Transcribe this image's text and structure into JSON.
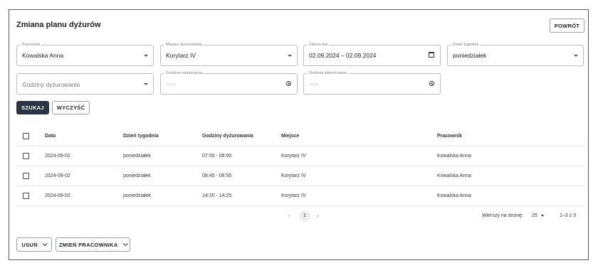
{
  "page": {
    "title": "Zmiana planu dyżurów"
  },
  "actions": {
    "back": "POWRÓT",
    "search": "SZUKAJ",
    "clear": "WYCZYŚĆ",
    "delete": "USUŃ",
    "change_employee": "ZMIEŃ PRACOWNIKA"
  },
  "filters": {
    "employee": {
      "label": "Pracownik",
      "value": "Kowalska Anna"
    },
    "place": {
      "label": "Miejsce dyżurowania",
      "value": "Korytarz IV"
    },
    "date_range": {
      "label": "Zakres dat",
      "value": "02.09.2024 – 02.09.2024"
    },
    "weekday": {
      "label": "Dzień tygodnia",
      "value": "poniedziałek"
    },
    "hours": {
      "placeholder": "Godziny dyżurowania"
    },
    "start_time": {
      "label": "Godzina rozpoczęcia",
      "value": "--:--"
    },
    "end_time": {
      "label": "Godzina zakończenia",
      "value": "--:--"
    }
  },
  "table": {
    "columns": [
      "Data",
      "Dzień tygodnia",
      "Godziny dyżurowania",
      "Miejsce",
      "Pracownik"
    ],
    "rows": [
      [
        "2024-09-02",
        "poniedziałek",
        "07:55 - 08:00",
        "Korytarz IV",
        "Kowalska Anna"
      ],
      [
        "2024-09-02",
        "poniedziałek",
        "08:45 - 08:55",
        "Korytarz IV",
        "Kowalska Anna"
      ],
      [
        "2024-09-02",
        "poniedziałek",
        "14:20 - 14:25",
        "Korytarz IV",
        "Kowalska Anna"
      ]
    ]
  },
  "pagination": {
    "current_page": "1",
    "prev": "‹",
    "next": "›",
    "rows_per_page_label": "Wierszy na stronę:",
    "rows_per_page": "25",
    "range": "1–3 z 3"
  },
  "icons": {
    "dropdown": "chevron-down-icon",
    "calendar": "calendar-icon",
    "clock": "clock-icon"
  }
}
